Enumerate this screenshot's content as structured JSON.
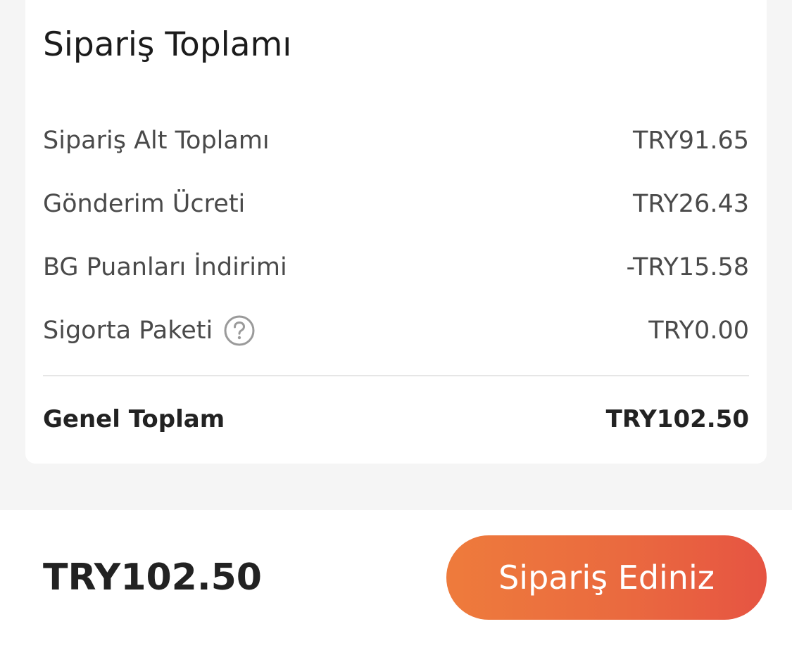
{
  "summary": {
    "title": "Sipariş Toplamı",
    "rows": [
      {
        "label": "Sipariş Alt Toplamı",
        "value": "TRY91.65"
      },
      {
        "label": "Gönderim Ücreti",
        "value": "TRY26.43"
      },
      {
        "label": "BG Puanları İndirimi",
        "value": "-TRY15.58"
      },
      {
        "label": "Sigorta Paketi",
        "value": "TRY0.00",
        "icon": "help-circle-icon"
      }
    ],
    "total": {
      "label": "Genel Toplam",
      "value": "TRY102.50"
    }
  },
  "bottom_bar": {
    "total": "TRY102.50",
    "button_label": "Sipariş Ediniz"
  },
  "colors": {
    "accent_gradient_start": "#ee7b3c",
    "accent_gradient_end": "#e65442",
    "page_background": "#f5f5f5",
    "card_background": "#ffffff"
  }
}
